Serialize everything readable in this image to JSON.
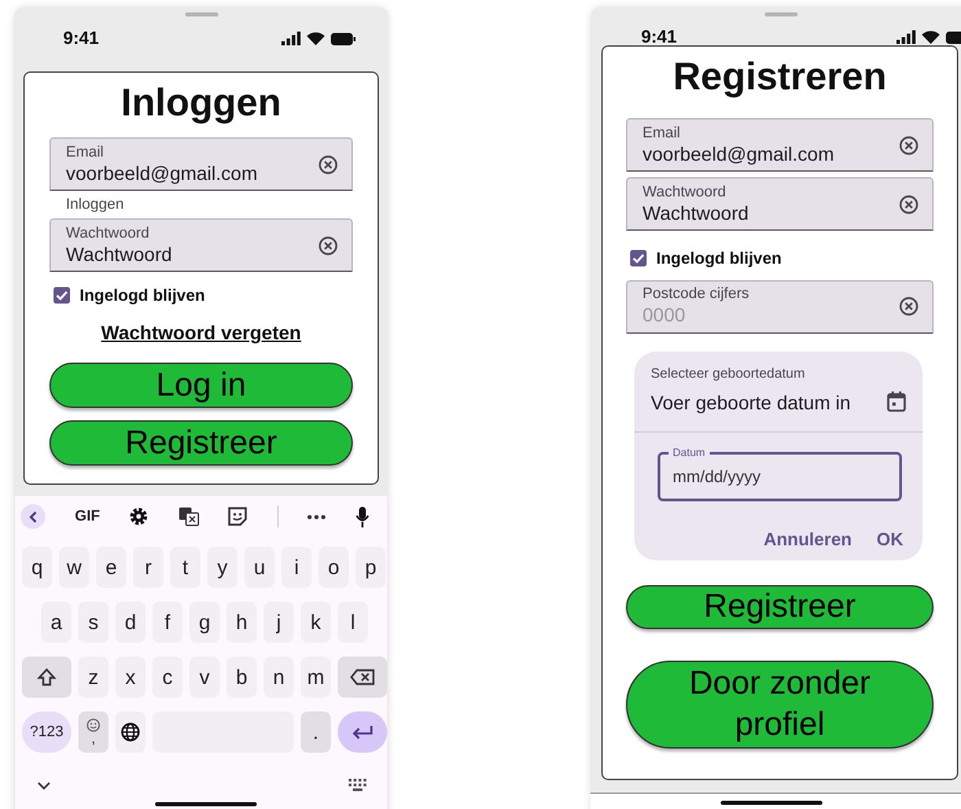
{
  "login_screen": {
    "status_bar": {
      "time": "9:41"
    },
    "title": "Inloggen",
    "items": [
      {
        "kind": "field",
        "label": "Email",
        "value": "voorbeeld@gmail.com"
      },
      {
        "kind": "caption",
        "text": "Inloggen"
      },
      {
        "kind": "field",
        "label": "Wachtwoord",
        "value": "Wachtwoord"
      },
      {
        "kind": "checkbox",
        "label": "Ingelogd blijven",
        "checked": true
      },
      {
        "kind": "link",
        "text": "Wachtwoord vergeten"
      },
      {
        "kind": "button",
        "label": "Log in"
      },
      {
        "kind": "button",
        "label": "Registreer"
      }
    ],
    "keyboard": {
      "toolbar_label": "GIF",
      "rows": [
        [
          "q",
          "w",
          "e",
          "r",
          "t",
          "y",
          "u",
          "i",
          "o",
          "p"
        ],
        [
          "a",
          "s",
          "d",
          "f",
          "g",
          "h",
          "j",
          "k",
          "l"
        ],
        [
          "z",
          "x",
          "c",
          "v",
          "b",
          "n",
          "m"
        ]
      ],
      "symbols_key": "?123",
      "comma_key": ",",
      "period_key": "."
    }
  },
  "register_screen": {
    "status_bar": {
      "time": "9:41"
    },
    "title": "Registreren",
    "items": [
      {
        "kind": "field",
        "label": "Email",
        "value": "voorbeeld@gmail.com"
      },
      {
        "kind": "field",
        "label": "Wachtwoord",
        "value": "Wachtwoord"
      },
      {
        "kind": "checkbox",
        "label": "Ingelogd blijven",
        "checked": true
      },
      {
        "kind": "field",
        "label": "Postcode cijfers",
        "placeholder": "0000"
      },
      {
        "kind": "date_picker",
        "headline": "Selecteer geboortedatum",
        "prompt": "Voer geboorte datum in",
        "input": {
          "label": "Datum",
          "placeholder": "mm/dd/yyyy"
        },
        "actions": [
          "Annuleren",
          "OK"
        ]
      },
      {
        "kind": "button",
        "label": "Registreer"
      },
      {
        "kind": "button",
        "label": "Door zonder profiel"
      }
    ]
  }
}
